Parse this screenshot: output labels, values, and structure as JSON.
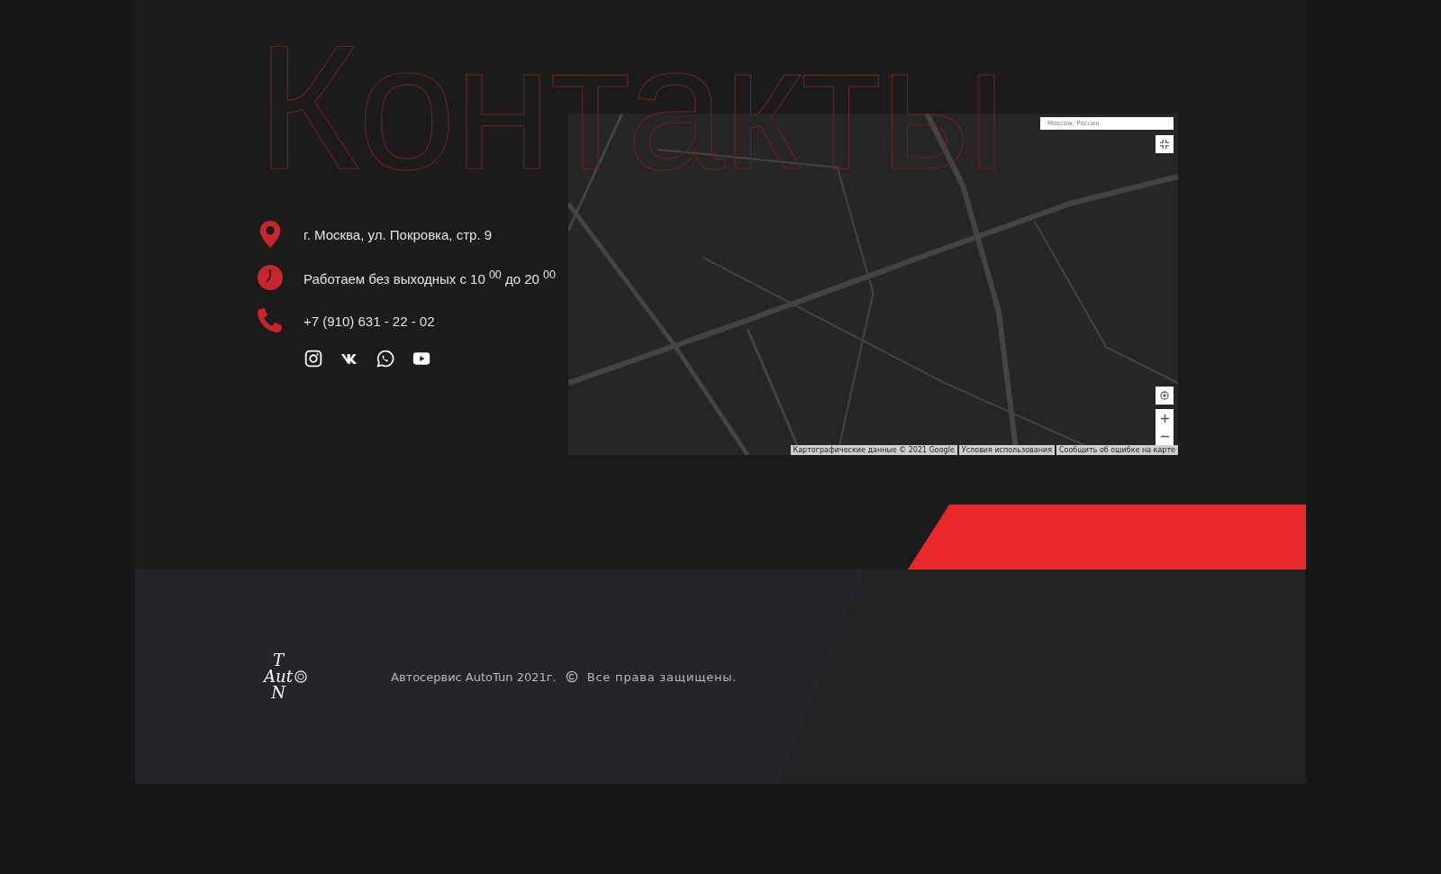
{
  "heading": "Контакты",
  "contacts": [
    {
      "kind": "address",
      "text": "г. Москва, ул. Покровка, стр. 9"
    },
    {
      "kind": "hours",
      "text": "Работаем без выходных с 10 $^{00}$ до 20 $^{00}$"
    },
    {
      "kind": "phone",
      "text": "+7 (910) 631 - 22 - 02"
    }
  ],
  "social": [
    {
      "kind": "instagram"
    },
    {
      "kind": "vk"
    },
    {
      "kind": "whatsapp"
    },
    {
      "kind": "youtube"
    }
  ],
  "map": {
    "search_value": "Moscow, Россия",
    "attribution": [
      "Картографические данные © 2021 Google",
      "Условия использования",
      "Сообщить об ошибке на карте"
    ]
  },
  "footer": {
    "logo": {
      "top": "T",
      "middle": "Aut",
      "bottom": "N"
    },
    "copyright": "Автосервис AutoTun 2021г.",
    "rights": "Все права защищены."
  }
}
